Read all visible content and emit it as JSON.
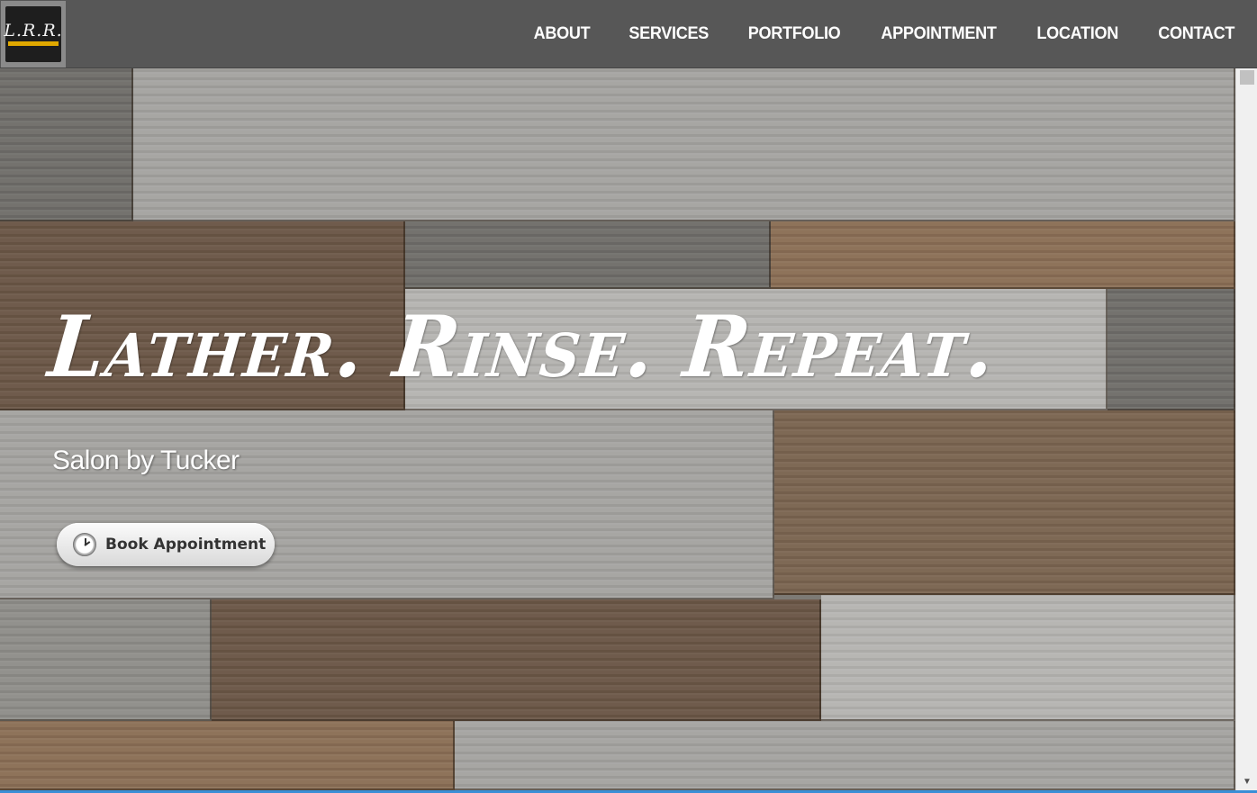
{
  "logo": {
    "text": "L.R.R."
  },
  "nav": {
    "items": [
      {
        "label": "ABOUT"
      },
      {
        "label": "SERVICES"
      },
      {
        "label": "PORTFOLIO"
      },
      {
        "label": "APPOINTMENT"
      },
      {
        "label": "LOCATION"
      },
      {
        "label": "CONTACT"
      }
    ]
  },
  "hero": {
    "title": "Lather. Rinse. Repeat.",
    "subtitle": "Salon by Tucker",
    "book_button_label": "Book Appointment"
  },
  "colors": {
    "navbar": "#575757",
    "nav_text": "#ffffff",
    "logo_accent": "#e0a800",
    "button_text": "#333333"
  },
  "icons": {
    "button_icon": "clock-icon",
    "scroll_down": "chevron-down-icon"
  }
}
